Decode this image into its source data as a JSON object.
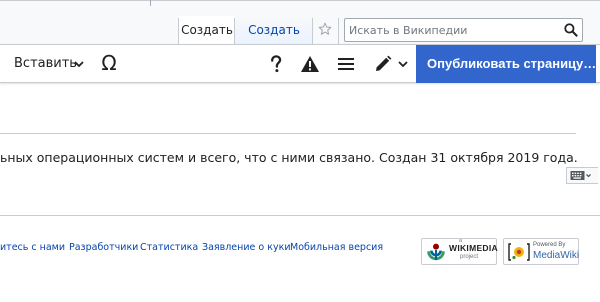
{
  "header": {
    "tabs": [
      {
        "label": "Создать",
        "selected": true
      },
      {
        "label": "Создать код",
        "selected": false
      }
    ],
    "watch_icon": "star-icon",
    "search": {
      "placeholder": "Искать в Википедии",
      "value": "",
      "icon": "search-icon"
    }
  },
  "toolbar": {
    "insert_label": "Вставить",
    "special_char_label": "Ω",
    "help_icon": "question-icon",
    "notices_icon": "warning-icon",
    "page_options_icon": "menu-icon",
    "edit_mode_icon": "pencil-icon",
    "publish_label": "Опубликовать страницу…",
    "publish_color": "#3366cc"
  },
  "content": {
    "text": "ьных операционных систем и всего, что с ними связано. Создан 31 октября 2019 года.",
    "keyboard_icon": "keyboard-icon"
  },
  "footer": {
    "links": [
      "итесь с нами",
      "Разработчики",
      "Статистика",
      "Заявление о куки",
      "Мобильная версия"
    ],
    "wikimedia_badge": {
      "small": "a",
      "name": "WIKIMEDIA",
      "sub": "project"
    },
    "mediawiki_badge": {
      "small": "Powered By",
      "name": "MediaWiki"
    }
  },
  "colors": {
    "link": "#0645ad",
    "border": "#c8ccd1",
    "accent": "#3366cc"
  }
}
